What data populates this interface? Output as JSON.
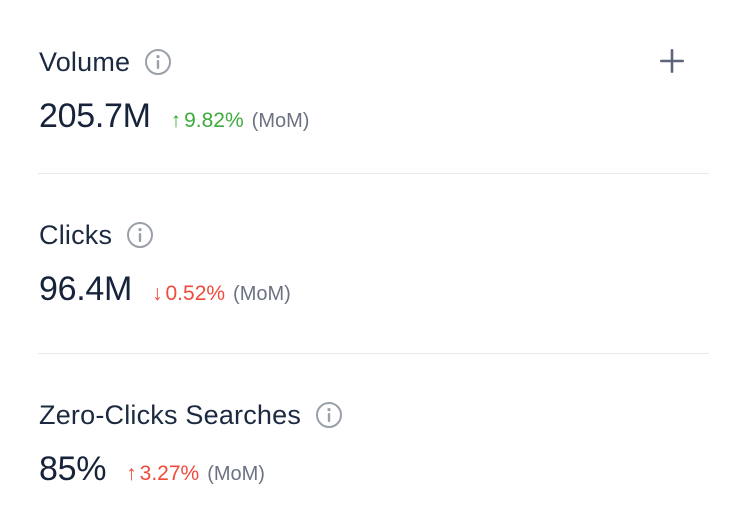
{
  "add_button": {
    "icon": "plus-icon",
    "color": "#5c6678"
  },
  "metrics": [
    {
      "label": "Volume",
      "value": "205.7M",
      "change": "9.82%",
      "direction": "up",
      "change_color": "#3cac3c",
      "period": "(MoM)"
    },
    {
      "label": "Clicks",
      "value": "96.4M",
      "change": "0.52%",
      "direction": "down",
      "change_color": "#ef4a3a",
      "period": "(MoM)"
    },
    {
      "label": "Zero-Clicks Searches",
      "value": "85%",
      "change": "3.27%",
      "direction": "up",
      "change_color": "#ef4a3a",
      "period": "(MoM)"
    }
  ],
  "arrows": {
    "up": "↑",
    "down": "↓"
  }
}
